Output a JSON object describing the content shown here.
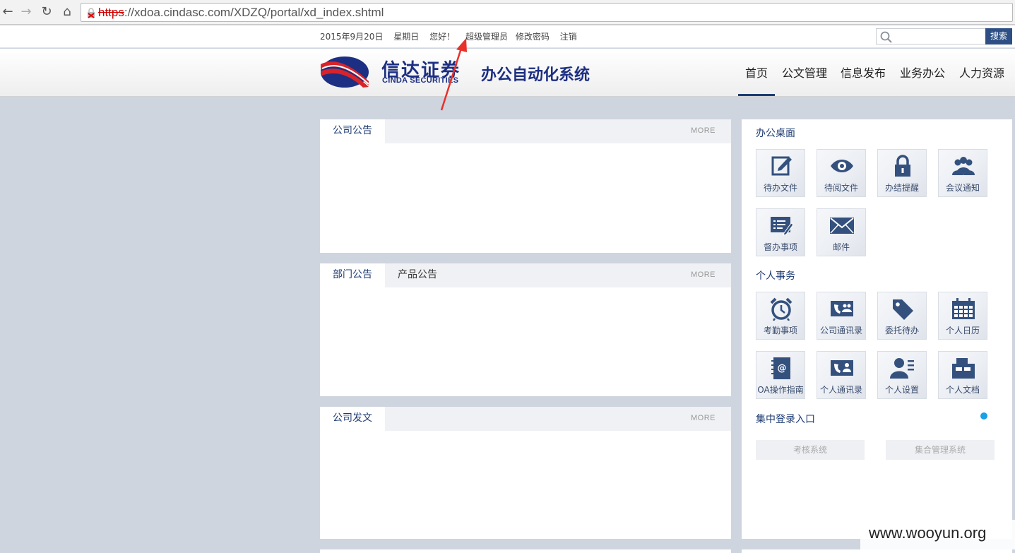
{
  "browser": {
    "url_protocol": "https",
    "url_rest": "://xdoa.cindasc.com/XDZQ/portal/xd_index.shtml"
  },
  "topbar": {
    "date": "2015年9月20日",
    "weekday": "星期日",
    "greeting": "您好！",
    "username": "超级管理员",
    "change_password": "修改密码",
    "logout": "注销",
    "search_button": "搜索"
  },
  "header": {
    "logo_cn": "信达证券",
    "logo_en": "CINDA SECURITIES",
    "system_title": "办公自动化系统",
    "nav": [
      "首页",
      "公文管理",
      "信息发布",
      "业务办公",
      "人力资源"
    ]
  },
  "panels": {
    "announcement": {
      "tab": "公司公告",
      "more": "MORE"
    },
    "dept": {
      "tab1": "部门公告",
      "tab2": "产品公告",
      "more": "MORE"
    },
    "docs": {
      "tab": "公司发文",
      "more": "MORE"
    }
  },
  "sidebar": {
    "office_title": "办公桌面",
    "office_items": [
      {
        "label": "待办文件",
        "icon": "edit-icon"
      },
      {
        "label": "待阅文件",
        "icon": "eye-icon"
      },
      {
        "label": "办结提醒",
        "icon": "lock-icon"
      },
      {
        "label": "会议通知",
        "icon": "people-icon"
      },
      {
        "label": "督办事项",
        "icon": "checklist-icon"
      },
      {
        "label": "邮件",
        "icon": "mail-icon"
      }
    ],
    "personal_title": "个人事务",
    "personal_items": [
      {
        "label": "考勤事项",
        "icon": "alarm-clock-icon"
      },
      {
        "label": "公司通讯录",
        "icon": "company-contacts-icon"
      },
      {
        "label": "委托待办",
        "icon": "tag-icon"
      },
      {
        "label": "个人日历",
        "icon": "calendar-icon"
      },
      {
        "label": "OA操作指南",
        "icon": "guide-book-icon"
      },
      {
        "label": "个人通讯录",
        "icon": "personal-contacts-icon"
      },
      {
        "label": "个人设置",
        "icon": "user-settings-icon"
      },
      {
        "label": "个人文档",
        "icon": "file-cabinet-icon"
      }
    ],
    "sso_title": "集中登录入口",
    "sso_buttons": [
      "考核系统",
      "集合管理系统"
    ]
  },
  "watermark": "www.wooyun.org",
  "colors": {
    "brand": "#1d3b72",
    "accent": "#1aa0e6",
    "search": "#2d4f85",
    "arrow": "#e8312a"
  }
}
